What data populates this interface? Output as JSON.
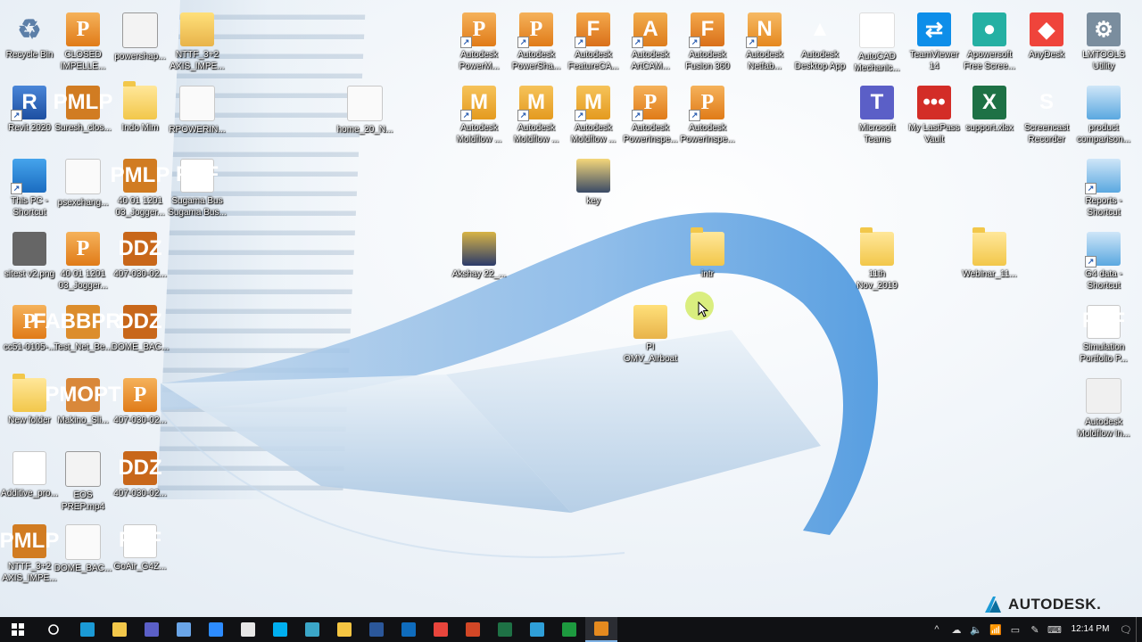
{
  "desktop": {
    "icons": [
      {
        "id": "recycle-bin",
        "label": "Recycle Bin",
        "glyph": "recycle-icon",
        "text": "♻",
        "shortcut": false
      },
      {
        "id": "closed-impeller",
        "label": "CLOSED\nIMPELLE...",
        "glyph": "adsk-p",
        "text": "P",
        "shortcut": false
      },
      {
        "id": "powershape-video",
        "label": "powershap...",
        "glyph": "video",
        "text": "",
        "shortcut": false
      },
      {
        "id": "nttf-axis-1",
        "label": "NTTF_3+2\nAXIS_IMPE...",
        "glyph": "winrar",
        "text": "",
        "shortcut": false
      },
      {
        "id": "powermill",
        "label": "Autodesk\nPowerM...",
        "glyph": "adsk-p",
        "text": "P",
        "shortcut": true
      },
      {
        "id": "powershape",
        "label": "Autodesk\nPowerSha...",
        "glyph": "adsk-p",
        "text": "P",
        "shortcut": true
      },
      {
        "id": "featurecam",
        "label": "Autodesk\nFeatureCA...",
        "glyph": "adsk-f",
        "text": "F",
        "shortcut": true
      },
      {
        "id": "artcam",
        "label": "Autodesk\nArtCAM...",
        "glyph": "adsk-a",
        "text": "A",
        "shortcut": true
      },
      {
        "id": "fusion360",
        "label": "Autodesk\nFusion 360",
        "glyph": "adsk-f",
        "text": "F",
        "shortcut": true
      },
      {
        "id": "netfabb",
        "label": "Autodesk\nNetfab...",
        "glyph": "adsk-n",
        "text": "N",
        "shortcut": true
      },
      {
        "id": "desktop-app",
        "label": "Autodesk\nDesktop App",
        "glyph": "desktopapp",
        "text": "▲",
        "shortcut": false
      },
      {
        "id": "autocad-mech",
        "label": "AutoCAD\nMechanic...",
        "glyph": "autocad",
        "text": "A",
        "shortcut": false
      },
      {
        "id": "teamviewer",
        "label": "TeamViewer\n14",
        "glyph": "teamviewer",
        "text": "⇄",
        "shortcut": false
      },
      {
        "id": "apowersoft",
        "label": "Apowersoft\nFree Scree...",
        "glyph": "apowersoft",
        "text": "●",
        "shortcut": false
      },
      {
        "id": "anydesk",
        "label": "AnyDesk",
        "glyph": "anydesk",
        "text": "◆",
        "shortcut": false
      },
      {
        "id": "lmtools",
        "label": "LMTOOLS\nUtility",
        "glyph": "lmtools",
        "text": "⚙",
        "shortcut": false
      },
      {
        "id": "revit",
        "label": "Revit 2020",
        "glyph": "revit",
        "text": "R",
        "shortcut": true
      },
      {
        "id": "suresh-pmlp",
        "label": "Suresh_clos...",
        "glyph": "pmlp",
        "text": "PMLP",
        "shortcut": false
      },
      {
        "id": "indo-mim",
        "label": "Indo Mim",
        "glyph": "folder",
        "text": "",
        "shortcut": false
      },
      {
        "id": "rpowerin",
        "label": "RPOWERIN...",
        "glyph": "file",
        "text": "",
        "shortcut": false
      },
      {
        "id": "home-20",
        "label": "home_20_N...",
        "glyph": "excel-sheet",
        "text": "",
        "shortcut": false
      },
      {
        "id": "moldflow-1",
        "label": "Autodesk\nMoldflow ...",
        "glyph": "adsk-m",
        "text": "M",
        "shortcut": true
      },
      {
        "id": "moldflow-2",
        "label": "Autodesk\nMoldflow ...",
        "glyph": "adsk-m",
        "text": "M",
        "shortcut": true
      },
      {
        "id": "moldflow-3",
        "label": "Autodesk\nMoldflow ...",
        "glyph": "adsk-m",
        "text": "M",
        "shortcut": true
      },
      {
        "id": "powerinspect-1",
        "label": "Autodesk\nPowerInspe...",
        "glyph": "adsk-p",
        "text": "P",
        "shortcut": true
      },
      {
        "id": "powerinspect-2",
        "label": "Autodesk\nPowerInspe...",
        "glyph": "adsk-p",
        "text": "P",
        "shortcut": true
      },
      {
        "id": "ms-teams",
        "label": "Microsoft\nTeams",
        "glyph": "teams",
        "text": "T",
        "shortcut": false
      },
      {
        "id": "lastpass",
        "label": "My LastPass\nVault",
        "glyph": "lastpass",
        "text": "•••",
        "shortcut": false
      },
      {
        "id": "support-xlsx",
        "label": "support.xlsx",
        "glyph": "excel",
        "text": "X",
        "shortcut": false
      },
      {
        "id": "screencast",
        "label": "Screencast\nRecorder",
        "glyph": "screencast",
        "text": "S",
        "shortcut": false
      },
      {
        "id": "product-comparison",
        "label": "product\ncomparison...",
        "glyph": "report",
        "text": "",
        "shortcut": false
      },
      {
        "id": "this-pc",
        "label": "This PC -\nShortcut",
        "glyph": "pc",
        "text": "",
        "shortcut": true
      },
      {
        "id": "psexchange",
        "label": "psexchang...",
        "glyph": "file",
        "text": "",
        "shortcut": false
      },
      {
        "id": "pmlp-40",
        "label": "40 01 1201\n03_Jogger...",
        "glyph": "pmlp",
        "text": "PMLP",
        "shortcut": false
      },
      {
        "id": "sugama-bus",
        "label": "Sugama Bus\nSugama Bus...",
        "glyph": "pdf",
        "text": "PDF",
        "shortcut": false
      },
      {
        "id": "key",
        "label": "key",
        "glyph": "key",
        "text": "",
        "shortcut": false
      },
      {
        "id": "reports",
        "label": "Reports -\nShortcut",
        "glyph": "report",
        "text": "",
        "shortcut": true
      },
      {
        "id": "sitest-png",
        "label": "sitest v2.png",
        "glyph": "png",
        "text": "",
        "shortcut": false
      },
      {
        "id": "p-40",
        "label": "40 01 1201\n03_Jogger...",
        "glyph": "adsk-p",
        "text": "P",
        "shortcut": false
      },
      {
        "id": "ddz-407-1",
        "label": "407-030-02...",
        "glyph": "ddz",
        "text": "DDZ",
        "shortcut": false
      },
      {
        "id": "akshay",
        "label": "Akshay 22_...",
        "glyph": "akshay",
        "text": "",
        "shortcut": false
      },
      {
        "id": "intr",
        "label": "intr",
        "glyph": "folder",
        "text": "",
        "shortcut": false
      },
      {
        "id": "nov-2019",
        "label": "11th\nNov_2019",
        "glyph": "folder",
        "text": "",
        "shortcut": false
      },
      {
        "id": "webinar",
        "label": "Webinar_11...",
        "glyph": "folder",
        "text": "",
        "shortcut": false
      },
      {
        "id": "g4-data",
        "label": "G4 data -\nShortcut",
        "glyph": "report",
        "text": "",
        "shortcut": true
      },
      {
        "id": "cc51",
        "label": "cc51-0105-...",
        "glyph": "adsk-p",
        "text": "P",
        "shortcut": false
      },
      {
        "id": "test-net",
        "label": "Test_Net_Be...",
        "glyph": "fabbprj",
        "text": "FABBPRJ",
        "shortcut": false
      },
      {
        "id": "dome-bac-1",
        "label": "DOME_BAC...",
        "glyph": "ddz",
        "text": "DDZ",
        "shortcut": false
      },
      {
        "id": "omv-airboat",
        "label": "PI\nOMV_Airboat",
        "glyph": "winrar",
        "text": "",
        "shortcut": false
      },
      {
        "id": "simulation-portfolio",
        "label": "Simulation\nPortfolio P...",
        "glyph": "pdf",
        "text": "PDF",
        "shortcut": false
      },
      {
        "id": "new-folder",
        "label": "New folder",
        "glyph": "folder",
        "text": "",
        "shortcut": false
      },
      {
        "id": "makino",
        "label": "Makino_Sli...",
        "glyph": "pmopt",
        "text": "PMOPT",
        "shortcut": false
      },
      {
        "id": "p-407",
        "label": "407-030-02...",
        "glyph": "adsk-p",
        "text": "P",
        "shortcut": false
      },
      {
        "id": "moldflow-in",
        "label": "Autodesk\nMoldflow In...",
        "glyph": "ppt",
        "text": "",
        "shortcut": false
      },
      {
        "id": "additive-pro",
        "label": "Additive_pro...",
        "glyph": "pdf-small",
        "text": "",
        "shortcut": false
      },
      {
        "id": "eos-prep",
        "label": "EOS\nPREP.mp4",
        "glyph": "video",
        "text": "",
        "shortcut": false
      },
      {
        "id": "ddz-407-2",
        "label": "407-030-02...",
        "glyph": "ddz",
        "text": "DDZ",
        "shortcut": false
      },
      {
        "id": "nttf-axis-2",
        "label": "NTTF_3+2\nAXIS_IMPE...",
        "glyph": "pmlp",
        "text": "PMLP",
        "shortcut": false
      },
      {
        "id": "dome-bac-2",
        "label": "DOME_BAC...",
        "glyph": "file",
        "text": "",
        "shortcut": false
      },
      {
        "id": "goair",
        "label": "GoAir_G4Z...",
        "glyph": "pdf",
        "text": "PDF",
        "shortcut": false
      }
    ]
  },
  "watermark": {
    "brand": "AUTODESK."
  },
  "taskbar": {
    "start_icon": "windows-icon",
    "search_icon": "search-icon",
    "apps": [
      {
        "name": "autodesk-desktop-app",
        "color": "#1b9ad6"
      },
      {
        "name": "file-explorer-pinned",
        "color": "#f2c74a"
      },
      {
        "name": "teams",
        "color": "#5b5fc7"
      },
      {
        "name": "notepad",
        "color": "#6aa5e8"
      },
      {
        "name": "zoom",
        "color": "#2d8cff"
      },
      {
        "name": "calculator",
        "color": "#e6e6e6"
      },
      {
        "name": "skype",
        "color": "#00aff0"
      },
      {
        "name": "snipping",
        "color": "#3ba6c8"
      },
      {
        "name": "file-explorer",
        "color": "#f5c542"
      },
      {
        "name": "word",
        "color": "#2b579a"
      },
      {
        "name": "outlook",
        "color": "#0f6cbd"
      },
      {
        "name": "chrome",
        "color": "#e8453c"
      },
      {
        "name": "powerpoint",
        "color": "#d24726"
      },
      {
        "name": "excel",
        "color": "#1e7145"
      },
      {
        "name": "edge",
        "color": "#2f9fd8"
      },
      {
        "name": "screencast",
        "color": "#1d9a3f"
      },
      {
        "name": "powerinspect-active",
        "color": "#e58a1f"
      }
    ],
    "tray": {
      "chevron": "^",
      "time": "12:14 PM",
      "date": ""
    }
  }
}
